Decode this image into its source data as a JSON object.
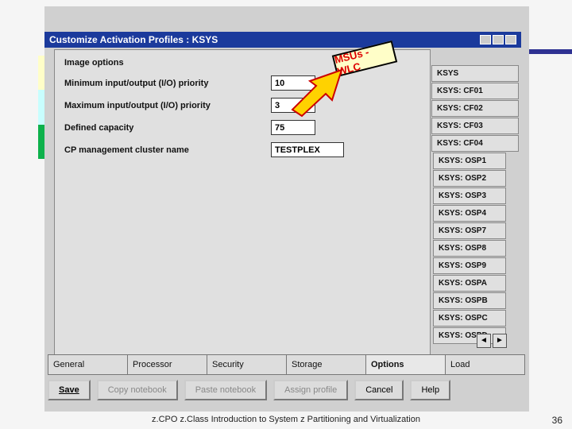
{
  "window": {
    "title": "Customize Activation Profiles : KSYS"
  },
  "section": {
    "heading": "Image options",
    "fields": {
      "min_io_label": "Minimum input/output (I/O) priority",
      "min_io_value": "10",
      "max_io_label": "Maximum input/output (I/O) priority",
      "max_io_value": "3",
      "defined_cap_label": "Defined capacity",
      "defined_cap_value": "75",
      "cluster_label": "CP management cluster name",
      "cluster_value": "TESTPLEX"
    }
  },
  "side_tabs": [
    "KSYS",
    "KSYS: CF01",
    "KSYS: CF02",
    "KSYS: CF03",
    "KSYS: CF04",
    "KSYS: OSP1",
    "KSYS: OSP2",
    "KSYS: OSP3",
    "KSYS: OSP4",
    "KSYS: OSP7",
    "KSYS: OSP8",
    "KSYS: OSP9",
    "KSYS: OSPA",
    "KSYS: OSPB",
    "KSYS: OSPC",
    "KSYS: OSPD"
  ],
  "bottom_tabs": [
    "General",
    "Processor",
    "Security",
    "Storage",
    "Options",
    "Load"
  ],
  "buttons": {
    "save": "Save",
    "copy": "Copy notebook",
    "paste": "Paste notebook",
    "assign": "Assign profile",
    "cancel": "Cancel",
    "help": "Help"
  },
  "callout": {
    "label": "MSUs - WLC"
  },
  "scroll": {
    "left": "◄",
    "right": "►"
  },
  "footer": "z.CPO z.Class  Introduction to System z Partitioning and Virtualization",
  "page": "36"
}
